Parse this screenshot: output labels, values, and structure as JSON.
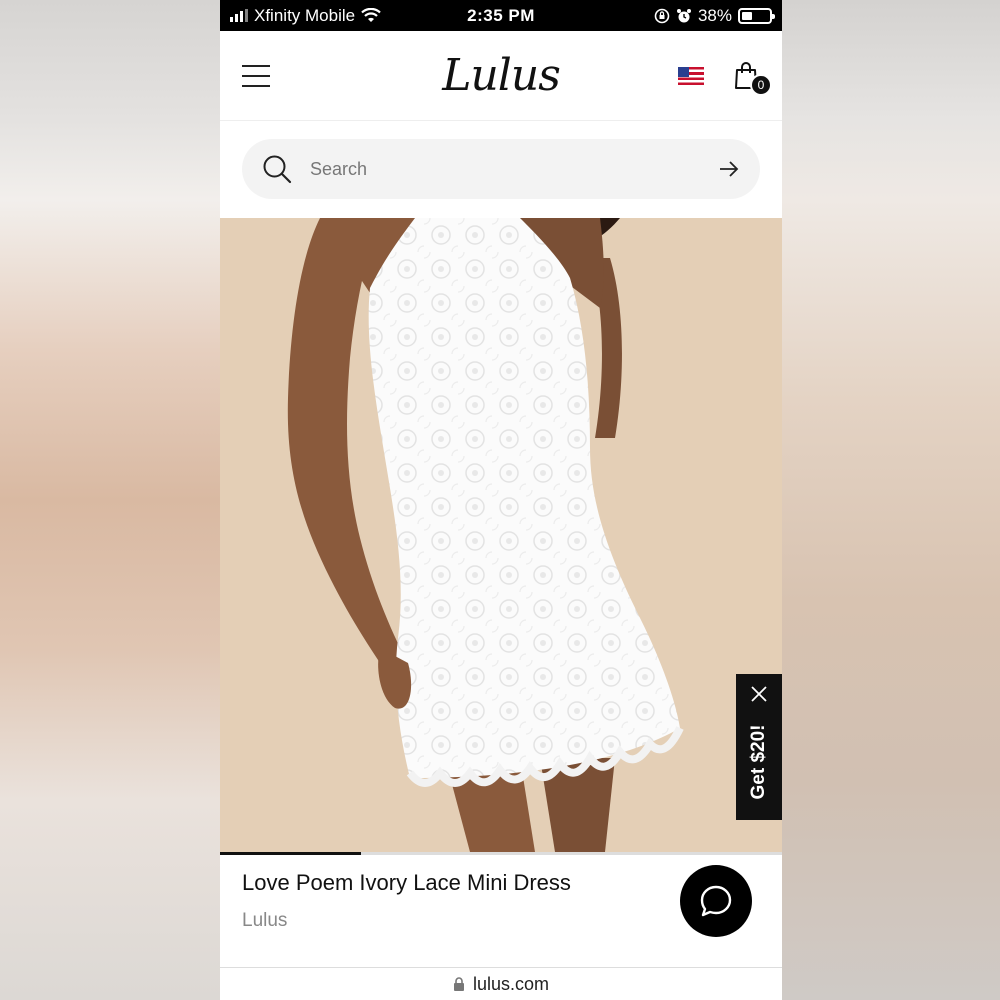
{
  "status_bar": {
    "carrier": "Xfinity Mobile",
    "time": "2:35 PM",
    "battery_percent": "38%",
    "battery_level": 0.38
  },
  "header": {
    "logo": "Lulus",
    "cart_count": "0",
    "country_flag": "us-flag-icon"
  },
  "search": {
    "placeholder": "Search"
  },
  "carousel": {
    "progress_fraction": 0.25
  },
  "promo": {
    "label": "Get $20!"
  },
  "product": {
    "name": "Love Poem Ivory Lace Mini Dress",
    "brand": "Lulus"
  },
  "browser": {
    "url": "lulus.com"
  },
  "colors": {
    "hero_background": "#e4cfb6",
    "dress": "#ffffff",
    "skin": "#8a5a3c",
    "accent": "#111111"
  }
}
